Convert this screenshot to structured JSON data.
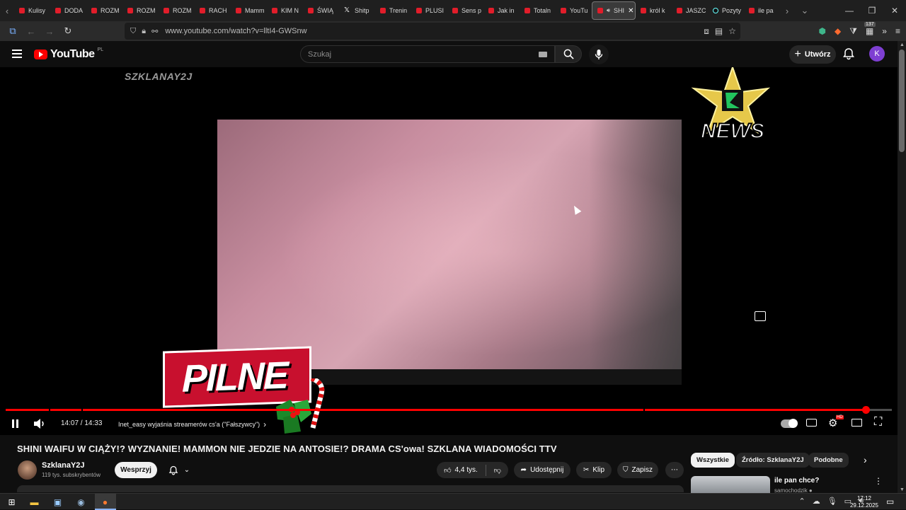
{
  "browser": {
    "tabs": [
      {
        "label": "Kulisy",
        "icon": "youtube-icon"
      },
      {
        "label": "DODA",
        "icon": "youtube-icon"
      },
      {
        "label": "ROZM",
        "icon": "youtube-icon"
      },
      {
        "label": "ROZM",
        "icon": "youtube-icon"
      },
      {
        "label": "ROZM",
        "icon": "youtube-icon"
      },
      {
        "label": "RACH",
        "icon": "youtube-icon"
      },
      {
        "label": "Mamm",
        "icon": "youtube-icon"
      },
      {
        "label": "KIM N",
        "icon": "youtube-icon"
      },
      {
        "label": "ŚWIĄ",
        "icon": "youtube-icon"
      },
      {
        "label": "Shitp",
        "icon": "x-icon"
      },
      {
        "label": "Trenin",
        "icon": "youtube-icon"
      },
      {
        "label": "PLUSI",
        "icon": "youtube-icon"
      },
      {
        "label": "Sens p",
        "icon": "youtube-icon"
      },
      {
        "label": "Jak in",
        "icon": "youtube-icon"
      },
      {
        "label": "Totaln",
        "icon": "youtube-icon"
      },
      {
        "label": "YouTu",
        "icon": "youtube-icon"
      },
      {
        "label": "SHI",
        "icon": "youtube-icon",
        "active": true
      },
      {
        "label": "król k",
        "icon": "youtube-icon"
      },
      {
        "label": "JASZC",
        "icon": "youtube-icon"
      },
      {
        "label": "Pozyty",
        "icon": "tiktok-icon"
      },
      {
        "label": "ile pa",
        "icon": "youtube-icon"
      }
    ],
    "url": "www.youtube.com/watch?v=lltI4-GWSnw",
    "extension_badge": "137"
  },
  "youtube": {
    "logo_text": "YouTube",
    "country_code": "PL",
    "search_placeholder": "Szukaj",
    "create_label": "Utwórz",
    "avatar_letter": "K"
  },
  "player": {
    "watermark": "SZKLANAY2J",
    "overlay_text": "PILNE",
    "news_logo_text": "NEWS",
    "current_time": "14:07",
    "duration": "14:33",
    "time_display": "14:07 / 14:33",
    "progress_fraction": 0.9702,
    "chapter_title": "Inet_easy wyjaśnia streamerów cs'a (\"Fałszywcy\")",
    "chapter_arrow": "›",
    "quality_badge": "HD",
    "autoplay_on": true
  },
  "video": {
    "title": "SHINI WAIFU W CIĄŻY!? WYZNANIE! MAMMON NIE JEDZIE NA ANTOSIE!? DRAMA CS'owa! SZKLANA WIADOMOŚCI TTV",
    "channel_name": "SzklanaY2J",
    "subscribers": "119 tys. subskrybentów",
    "support_label": "Wesprzyj",
    "likes": "4,4 tys.",
    "share_label": "Udostępnij",
    "clip_label": "Klip",
    "save_label": "Zapisz"
  },
  "sidebar": {
    "chips": [
      "Wszystkie",
      "Źródło: SzklanaY2J",
      "Podobne"
    ],
    "recommendation": {
      "title": "ile pan chce?",
      "channel": "samochodzik ●"
    }
  },
  "taskbar": {
    "time": "17:12",
    "date": "29.12.2025"
  },
  "colors": {
    "youtube_red": "#ff0000",
    "progress_red": "#ff0000",
    "avatar_purple": "#7e3fd2"
  }
}
